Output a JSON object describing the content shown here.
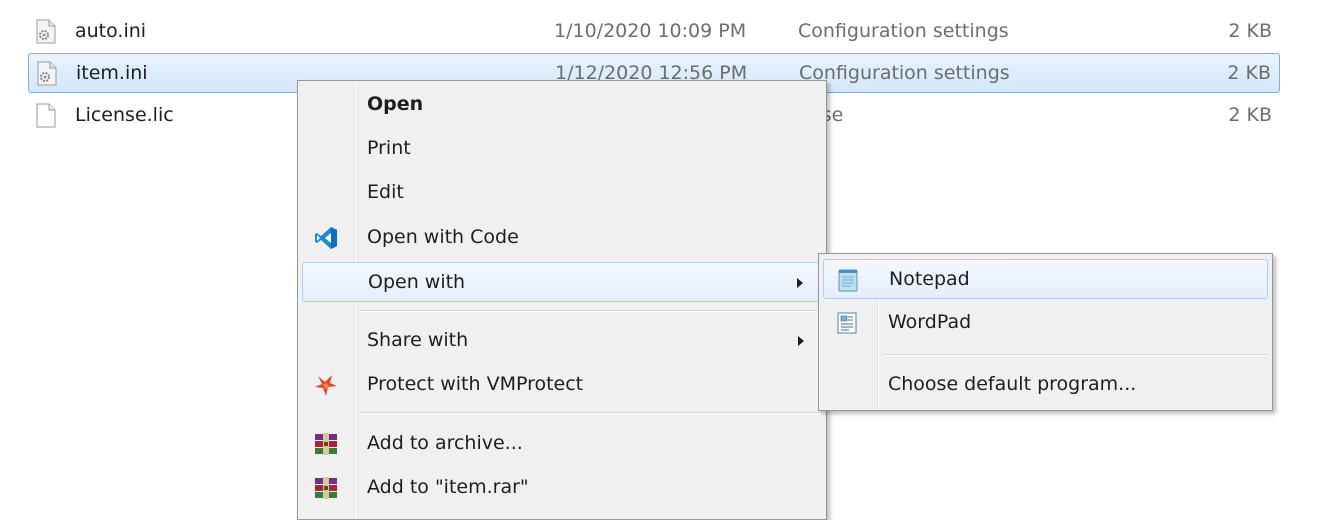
{
  "files": [
    {
      "name": "auto.ini",
      "date": "1/10/2020 10:09 PM",
      "type": "Configuration settings",
      "size": "2 KB",
      "icon": "settings-file-icon",
      "selected": false
    },
    {
      "name": "item.ini",
      "date": "1/12/2020 12:56 PM",
      "type": "Configuration settings",
      "size": "2 KB",
      "icon": "settings-file-icon",
      "selected": true
    },
    {
      "name": "License.lic",
      "date": "",
      "type": "ense",
      "size": "2 KB",
      "icon": "blank-file-icon",
      "selected": false
    }
  ],
  "context_menu": {
    "items": [
      {
        "label": "Open",
        "bold": true
      },
      {
        "label": "Print"
      },
      {
        "label": "Edit"
      },
      {
        "label": "Open with Code",
        "icon": "vscode-icon"
      },
      {
        "label": "Open with",
        "submenu": true,
        "hovered": true
      },
      {
        "label": "Share with",
        "submenu": true
      },
      {
        "label": "Protect with VMProtect",
        "icon": "vmprotect-icon"
      },
      {
        "label": "Add to archive...",
        "icon": "winrar-icon"
      },
      {
        "label": "Add to \"item.rar\"",
        "icon": "winrar-icon"
      }
    ]
  },
  "open_with_submenu": {
    "items": [
      {
        "label": "Notepad",
        "icon": "notepad-icon",
        "hovered": true
      },
      {
        "label": "WordPad",
        "icon": "wordpad-icon"
      },
      {
        "label": "Choose default program..."
      }
    ]
  },
  "colors": {
    "selection_border": "#84acdd",
    "menu_background": "#f0f0f0",
    "hover_border": "#aecff7",
    "vscode_blue": "#1f8ad2",
    "vmprotect_red": "#e2472b",
    "winrar_red": "#a8243a"
  }
}
